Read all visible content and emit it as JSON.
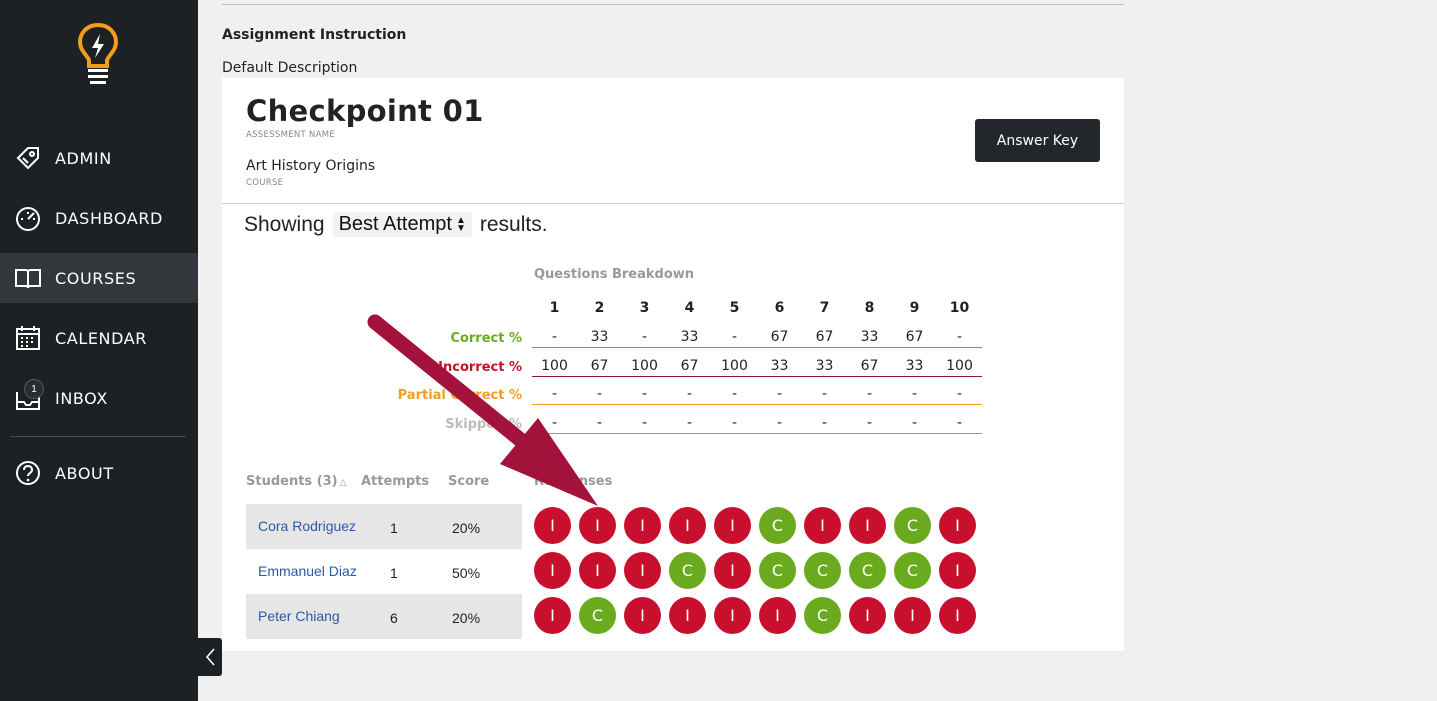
{
  "sidebar": {
    "items": [
      {
        "label": "ADMIN",
        "icon": "tag-icon"
      },
      {
        "label": "DASHBOARD",
        "icon": "gauge-icon"
      },
      {
        "label": "COURSES",
        "icon": "book-icon",
        "active": true
      },
      {
        "label": "CALENDAR",
        "icon": "calendar-icon"
      },
      {
        "label": "INBOX",
        "icon": "inbox-icon",
        "badge": "1"
      },
      {
        "label": "ABOUT",
        "icon": "help-icon"
      }
    ]
  },
  "instructions": {
    "title": "Assignment Instruction",
    "description": "Default Description"
  },
  "assessment": {
    "name": "Checkpoint 01",
    "name_label": "ASSESSMENT NAME",
    "course": "Art History Origins",
    "course_label": "COURSE",
    "answer_key_label": "Answer Key"
  },
  "results": {
    "prefix": "Showing",
    "selected": "Best Attempt",
    "suffix": "results."
  },
  "breakdown": {
    "title": "Questions Breakdown",
    "questions": [
      "1",
      "2",
      "3",
      "4",
      "5",
      "6",
      "7",
      "8",
      "9",
      "10"
    ],
    "rows": [
      {
        "label": "Correct %",
        "color": "#6aaa1e",
        "line": "#6aaa1e",
        "values": [
          "-",
          "33",
          "-",
          "33",
          "-",
          "67",
          "67",
          "33",
          "67",
          "-"
        ]
      },
      {
        "label": "Incorrect %",
        "color": "#c8102e",
        "line": "#8a1c2e",
        "values": [
          "100",
          "67",
          "100",
          "67",
          "100",
          "33",
          "33",
          "67",
          "33",
          "100"
        ]
      },
      {
        "label": "Partial Correct %",
        "color": "#f0a020",
        "line": "#f0a020",
        "values": [
          "-",
          "-",
          "-",
          "-",
          "-",
          "-",
          "-",
          "-",
          "-",
          "-"
        ]
      },
      {
        "label": "Skipped %",
        "color": "#bbbbbb",
        "line": "#999999",
        "values": [
          "-",
          "-",
          "-",
          "-",
          "-",
          "-",
          "-",
          "-",
          "-",
          "-"
        ]
      }
    ]
  },
  "students": {
    "headers": {
      "students": "Students (3)",
      "attempts": "Attempts",
      "score": "Score",
      "responses": "Responses"
    },
    "rows": [
      {
        "name": "Cora Rodriguez",
        "attempts": "1",
        "score": "20%",
        "responses": [
          "I",
          "I",
          "I",
          "I",
          "I",
          "C",
          "I",
          "I",
          "C",
          "I"
        ]
      },
      {
        "name": "Emmanuel Diaz",
        "attempts": "1",
        "score": "50%",
        "responses": [
          "I",
          "I",
          "I",
          "C",
          "I",
          "C",
          "C",
          "C",
          "C",
          "I"
        ]
      },
      {
        "name": "Peter Chiang",
        "attempts": "6",
        "score": "20%",
        "responses": [
          "I",
          "C",
          "I",
          "I",
          "I",
          "I",
          "C",
          "I",
          "I",
          "I"
        ]
      }
    ]
  },
  "colors": {
    "correct": "#6aaa1e",
    "incorrect": "#c8102e",
    "partial": "#f0a020",
    "annotation_arrow": "#a3123a"
  }
}
